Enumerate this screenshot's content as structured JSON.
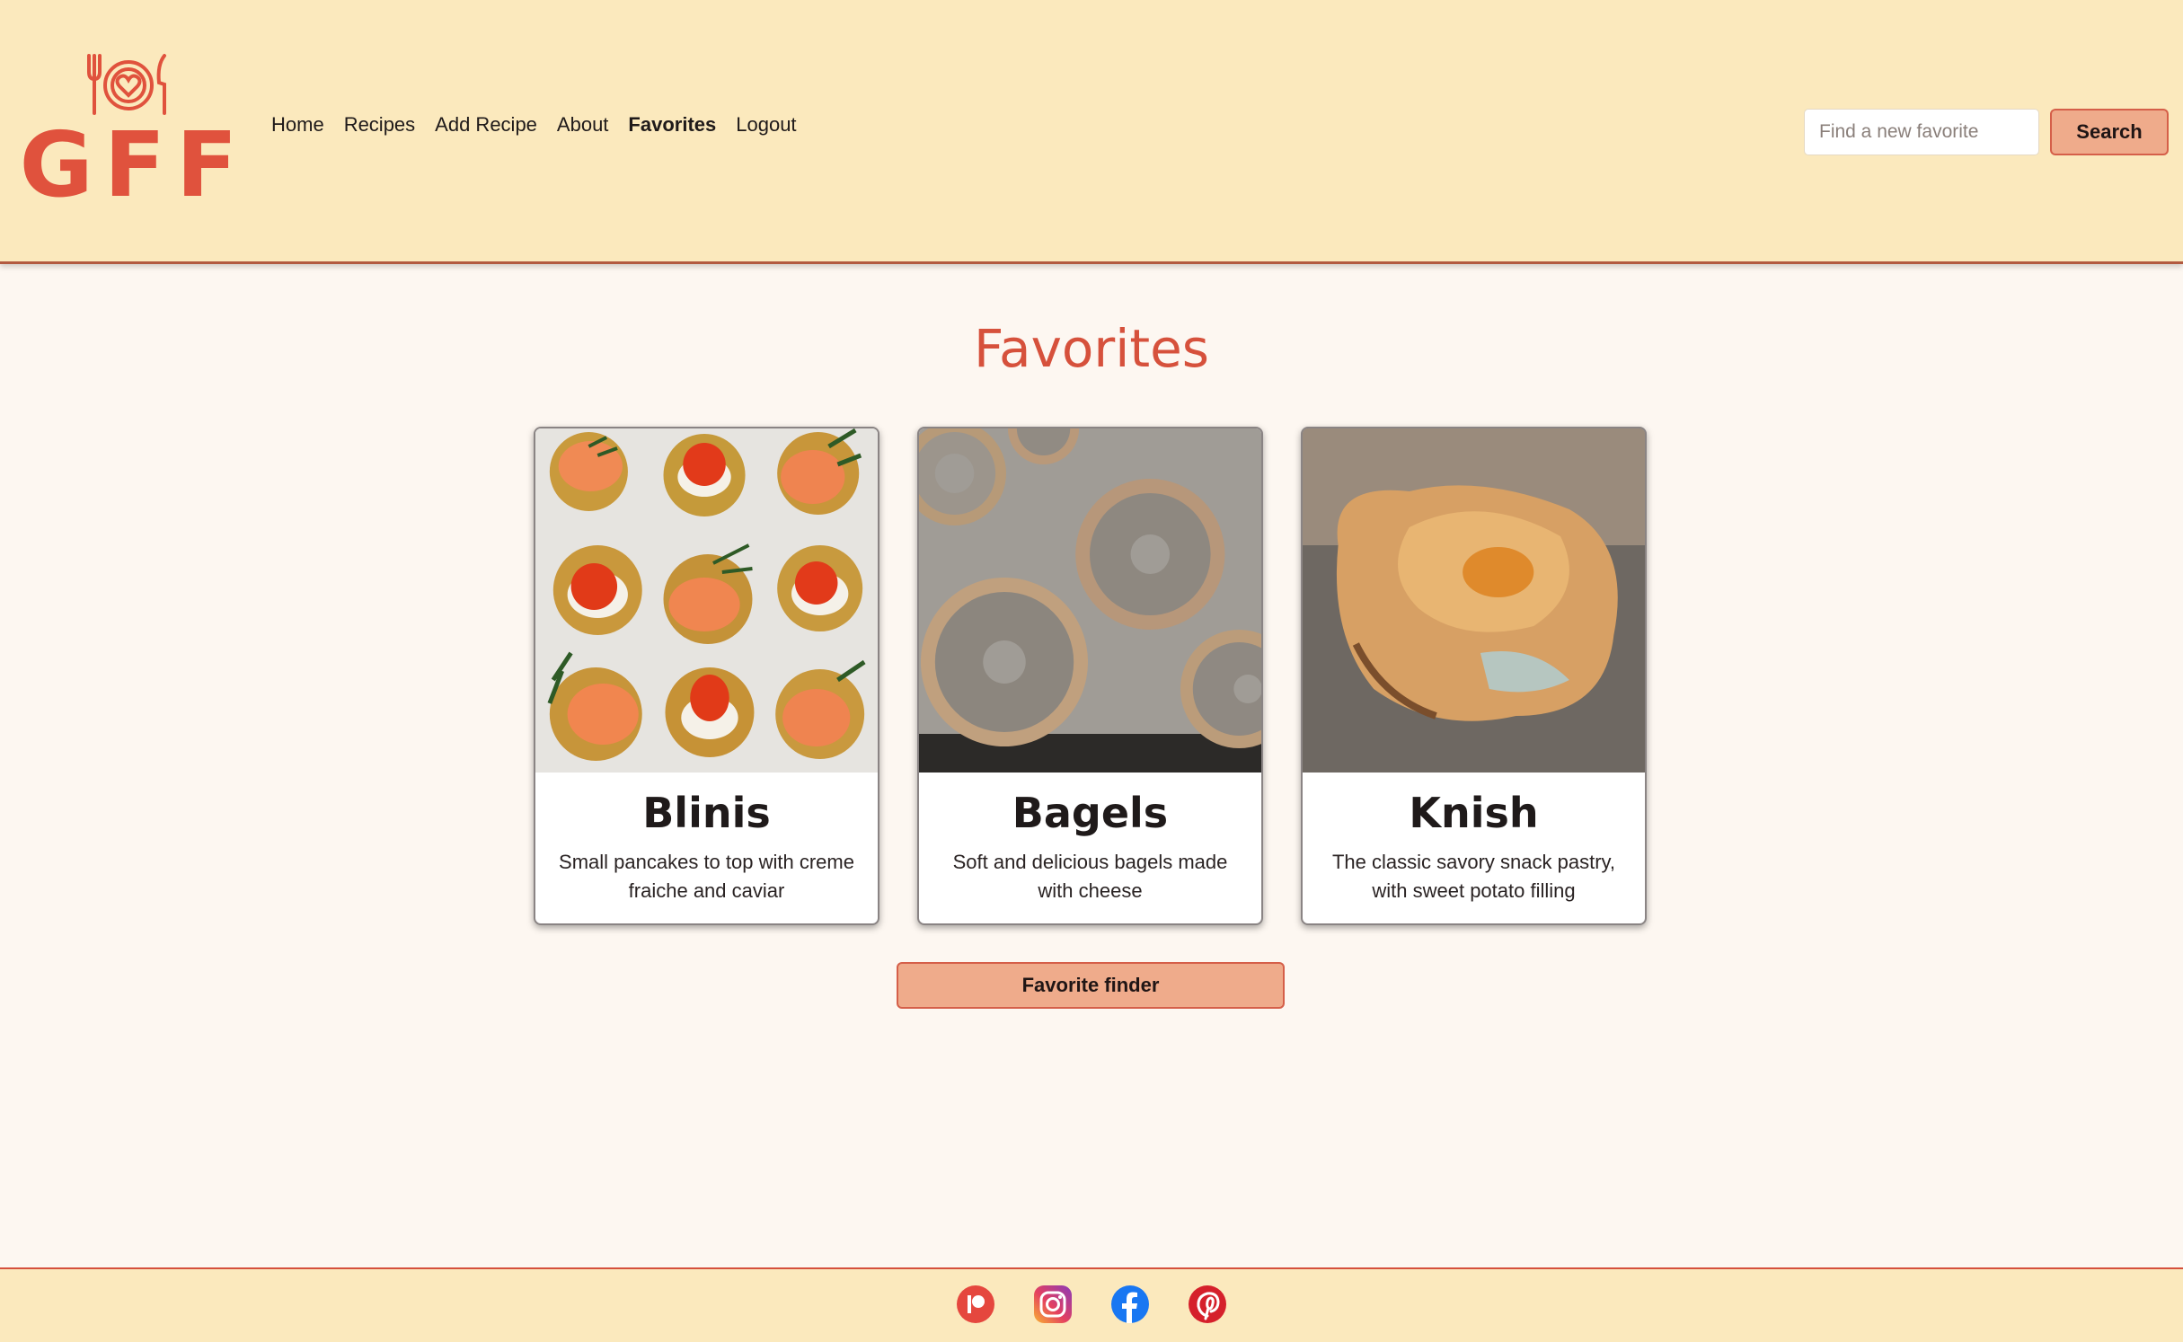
{
  "header": {
    "logo_text": "GFF",
    "nav": [
      {
        "label": "Home"
      },
      {
        "label": "Recipes"
      },
      {
        "label": "Add Recipe"
      },
      {
        "label": "About"
      },
      {
        "label": "Favorites",
        "active": true
      },
      {
        "label": "Logout"
      }
    ],
    "search": {
      "placeholder": "Find a new favorite",
      "button_label": "Search"
    }
  },
  "main": {
    "title": "Favorites",
    "cards": [
      {
        "title": "Blinis",
        "description": "Small pancakes to top with creme fraiche and caviar",
        "image": "blinis-photo"
      },
      {
        "title": "Bagels",
        "description": "Soft and delicious bagels made with cheese",
        "image": "bagels-photo"
      },
      {
        "title": "Knish",
        "description": "The classic savory snack pastry, with sweet potato filling",
        "image": "knish-photo"
      }
    ],
    "finder_button_label": "Favorite finder"
  },
  "footer": {
    "social_icons": [
      "patreon-icon",
      "instagram-icon",
      "facebook-icon",
      "pinterest-icon"
    ]
  },
  "colors": {
    "header_bg": "#fbe9bd",
    "page_bg": "#fdf7f1",
    "accent": "#d6513c",
    "button_bg": "#efab8b"
  }
}
